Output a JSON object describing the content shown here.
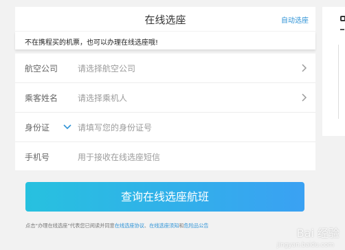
{
  "header": {
    "title": "在线选座",
    "auto_link": "自动选座"
  },
  "notice": {
    "text": "不在携程买的机票，也可以办理在线选座哦!"
  },
  "form": {
    "rows": [
      {
        "label": "航空公司",
        "placeholder": "请选择航空公司"
      },
      {
        "label": "乘客姓名",
        "placeholder": "请选择乘机人"
      },
      {
        "label": "身份证",
        "placeholder": "请填写您的身份证号"
      },
      {
        "label": "手机号",
        "placeholder": "用于接收在线选座短信"
      }
    ]
  },
  "submit": {
    "label": "查询在线选座航班"
  },
  "agreement": {
    "prefix": "点击“办理在线选座”代表您已阅读并同意",
    "link1": "在线选座协议",
    "sep": "、",
    "link2": "在线选座须知",
    "and": "和",
    "link3": "危险品公告"
  },
  "watermark": {
    "text": "Bai 经验",
    "sub": "jingyan.baidu.com"
  },
  "colors": {
    "accent": "#2f93d6",
    "button_start": "#27c1df",
    "button_end": "#3aa1f3"
  },
  "icons": [
    "chevron-right-icon",
    "chevron-down-icon"
  ]
}
